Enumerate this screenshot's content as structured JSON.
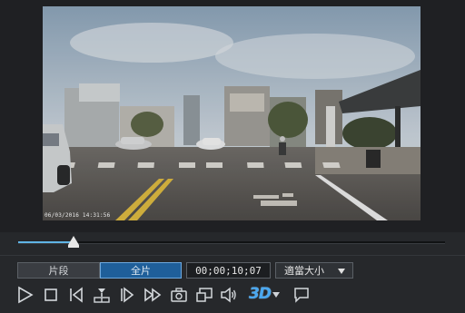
{
  "video": {
    "osd_timestamp": "06/03/2016 14:31:56"
  },
  "seek": {
    "progress": 0.13
  },
  "mode_tabs": {
    "clip_label": "片段",
    "full_label": "全片",
    "active": "full"
  },
  "timecode": "00;00;10;07",
  "zoom": {
    "selected": "適當大小"
  },
  "controls": {
    "three_d_label": "3D",
    "icons": [
      "play-icon",
      "stop-icon",
      "previous-frame-icon",
      "split-icon",
      "next-frame-icon",
      "fast-forward-icon",
      "snapshot-icon",
      "display-mode-icon",
      "volume-icon",
      "3d-icon",
      "dropdown-arrow-icon",
      "subtitle-icon"
    ]
  },
  "colors": {
    "accent": "#5fb4e6",
    "active_tab": "#1f5f9a",
    "three_d": "#4aa8f0"
  }
}
